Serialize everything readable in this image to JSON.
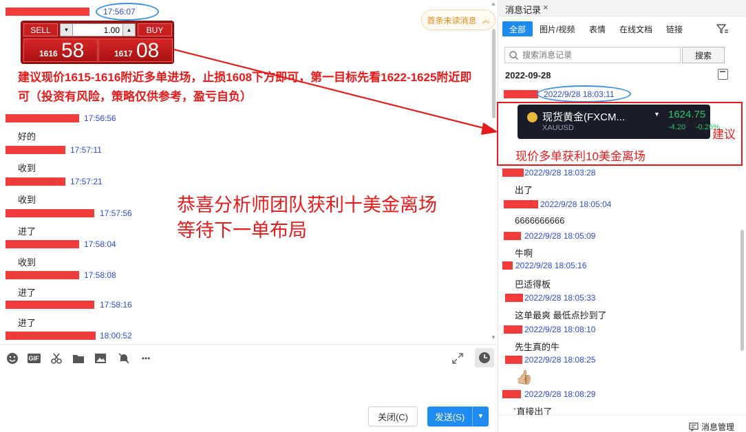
{
  "chat": {
    "header_time": "17:56:07",
    "unread_pill": "首条未读消息",
    "trade_widget": {
      "sell_label": "SELL",
      "buy_label": "BUY",
      "quantity": "1.00",
      "sell_small": "1616",
      "sell_big": "58",
      "buy_small": "1617",
      "buy_big": "08"
    },
    "advice_text": "建议现价1615-1616附近多单进场，止损1608下方即可，第一目标先看1622-1625附近即可（投资有风险，策略仅供参考，盈亏自负）",
    "messages": [
      {
        "time": "17:56:56",
        "text": "好的"
      },
      {
        "time": "17:57:11",
        "text": "收到"
      },
      {
        "time": "17:57:21",
        "text": "收到"
      },
      {
        "time": "17:57:56",
        "text": "进了"
      },
      {
        "time": "17:58:04",
        "text": "收到"
      },
      {
        "time": "17:58:08",
        "text": "进了"
      },
      {
        "time": "17:58:16",
        "text": "进了"
      },
      {
        "time": "18:00:52",
        "text": ""
      }
    ],
    "congrats_line1": "恭喜分析师团队获利十美金离场",
    "congrats_line2": "等待下一单布局",
    "toolbar": {
      "icons": [
        "emoji-icon",
        "gif-icon",
        "scissors-icon",
        "folder-icon",
        "image-icon",
        "mute-icon",
        "more-icon"
      ],
      "gif_label": "GIF",
      "more_label": "•••"
    },
    "close_label": "关闭(C)",
    "send_label": "发送(S)"
  },
  "history": {
    "tab_title": "消息记录",
    "close_glyph": "×",
    "filters": [
      "全部",
      "图片/视频",
      "表情",
      "在线文档",
      "链接"
    ],
    "search_placeholder": "搜索消息记录",
    "search_button": "搜索",
    "date_header": "2022-09-28",
    "first_time": "2022/9/28  18:03:11",
    "gold_card": {
      "name": "现货黄金(FXCM...",
      "symbol": "XAUUSD",
      "price": "1624.75",
      "change": "-4.20",
      "change_pct": "-0.26%"
    },
    "rec_suffix": "建议",
    "rec_line": "现价多单获利10美金离场",
    "entries": [
      {
        "time": "2022/9/28  18:03:28",
        "text": "出了"
      },
      {
        "time": "2022/9/28  18:05:04",
        "text": "6666666666"
      },
      {
        "time": "2022/9/28  18:05:09",
        "text": "牛啊"
      },
      {
        "time": "2022/9/28  18:05:16",
        "text": "巴适得板"
      },
      {
        "time": "2022/9/28  18:05:33",
        "text": "这单最爽 最低点抄到了"
      },
      {
        "time": "2022/9/28  18:08:10",
        "text": "先生真的牛"
      },
      {
        "time": "2022/9/28  18:08:25",
        "text": "👍🏼"
      },
      {
        "time": "2022/9/28  18:08:29",
        "text": "`直接出了"
      }
    ],
    "footer_label": "消息管理"
  },
  "colors": {
    "redaction": "#f23b3b",
    "timestamp": "#2b4bd6",
    "annotation_red": "#e51b1b",
    "accent_blue": "#1e8bf0",
    "gold_up": "#2ec46b"
  }
}
